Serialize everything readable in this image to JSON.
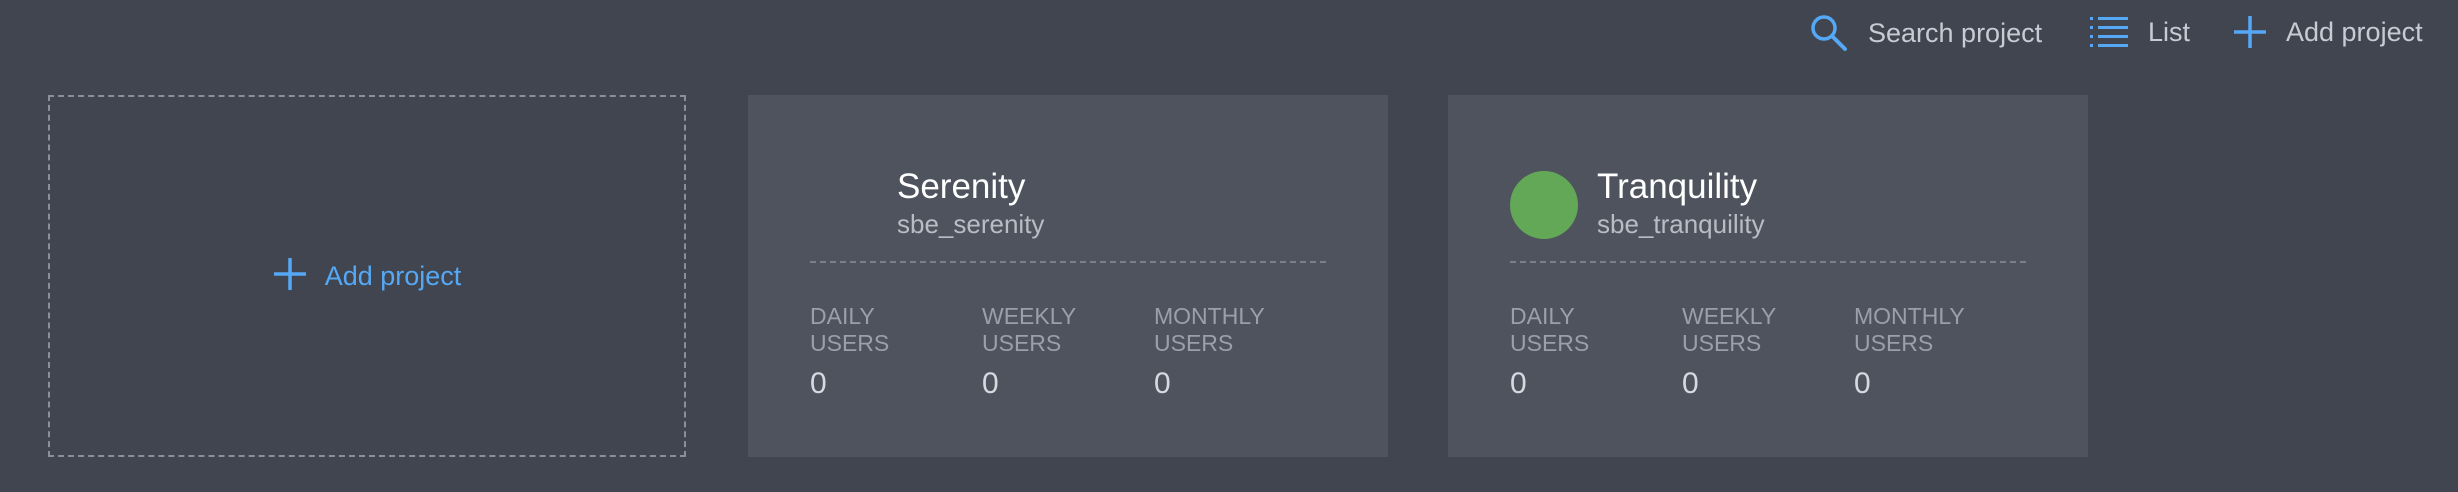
{
  "toolbar": {
    "search_label": "Search project",
    "list_label": "List",
    "add_label": "Add project"
  },
  "add_card": {
    "label": "Add project"
  },
  "projects": [
    {
      "name": "Serenity",
      "id": "sbe_serenity",
      "avatar_color": "",
      "stats": [
        {
          "label_line1": "DAILY",
          "label_line2": "USERS",
          "value": "0"
        },
        {
          "label_line1": "WEEKLY",
          "label_line2": "USERS",
          "value": "0"
        },
        {
          "label_line1": "MONTHLY",
          "label_line2": "USERS",
          "value": "0"
        }
      ]
    },
    {
      "name": "Tranquility",
      "id": "sbe_tranquility",
      "avatar_color": "#62a857",
      "stats": [
        {
          "label_line1": "DAILY",
          "label_line2": "USERS",
          "value": "0"
        },
        {
          "label_line1": "WEEKLY",
          "label_line2": "USERS",
          "value": "0"
        },
        {
          "label_line1": "MONTHLY",
          "label_line2": "USERS",
          "value": "0"
        }
      ]
    }
  ],
  "colors": {
    "background": "#40454f",
    "card": "#4e535d",
    "accent": "#55a8f5"
  },
  "icons": {
    "search": "search-icon",
    "list": "list-icon",
    "add": "plus-icon"
  }
}
